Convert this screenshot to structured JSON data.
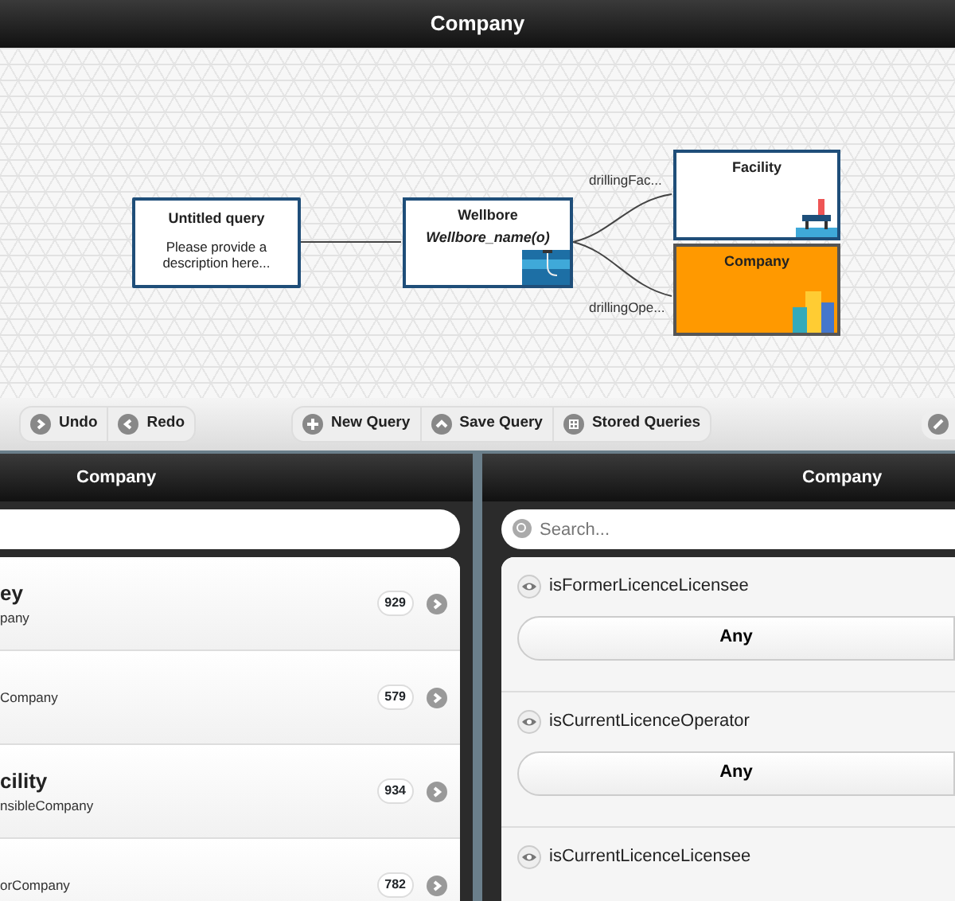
{
  "title": "Company",
  "canvas": {
    "nodes": [
      {
        "kind": "query",
        "title": "Untitled query",
        "description": "Please provide a description here...",
        "selected": false
      },
      {
        "kind": "entity",
        "title": "Wellbore",
        "subtitle": "Wellbore_name(o)",
        "selected": false
      },
      {
        "kind": "entity",
        "title": "Facility",
        "selected": false
      },
      {
        "kind": "entity",
        "title": "Company",
        "selected": true
      }
    ],
    "edges": [
      {
        "label": "drillingFac..."
      },
      {
        "label": "drillingOpe..."
      }
    ]
  },
  "toolbar": {
    "groups": [
      [
        "Undo",
        "Redo"
      ],
      [
        "New Query",
        "Save Query",
        "Stored Queries"
      ]
    ]
  },
  "left_panel": {
    "title": "Company",
    "items": [
      {
        "title": "ey",
        "subtitle": "pany",
        "count": "929"
      },
      {
        "subtitle": "Company",
        "count": "579"
      },
      {
        "title": "cility",
        "subtitle": "nsibleCompany",
        "count": "934"
      },
      {
        "subtitle": "orCompany",
        "count": "782"
      }
    ]
  },
  "right_panel": {
    "title": "Company",
    "search": {
      "placeholder": "Search..."
    },
    "properties": [
      {
        "name": "isFormerLicenceLicensee",
        "value": "Any"
      },
      {
        "name": "isCurrentLicenceOperator",
        "value": "Any"
      },
      {
        "name": "isCurrentLicenceLicensee"
      }
    ]
  }
}
